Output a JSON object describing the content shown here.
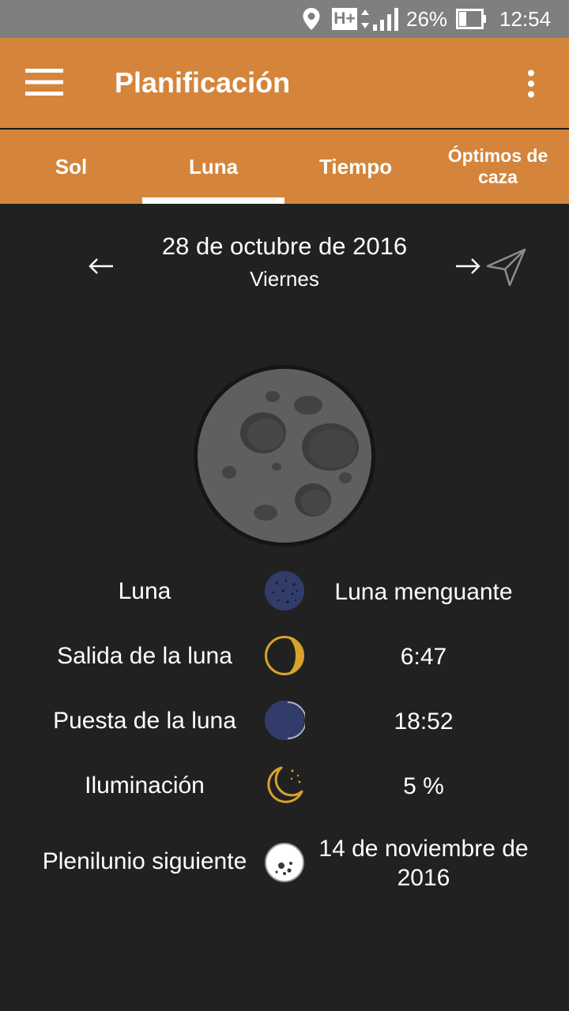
{
  "status_bar": {
    "network": "H+",
    "battery": "26%",
    "time": "12:54",
    "icons": [
      "location-icon",
      "network-icon",
      "signal-icon",
      "battery-icon"
    ]
  },
  "app_bar": {
    "title": "Planificación",
    "menu_icon": "hamburger-menu-icon",
    "overflow_icon": "more-vertical-icon"
  },
  "tabs": [
    {
      "label": "Sol",
      "selected": false
    },
    {
      "label": "Luna",
      "selected": true
    },
    {
      "label": "Tiempo",
      "selected": false
    },
    {
      "label": "Óptimos de caza",
      "selected": false
    }
  ],
  "date_nav": {
    "date": "28 de octubre de 2016",
    "weekday": "Viernes",
    "prev_icon": "arrow-left-icon",
    "next_icon": "arrow-right-icon",
    "location_icon": "navigation-icon"
  },
  "moon_info": {
    "rows": [
      {
        "label": "Luna",
        "icon": "moon-phase-icon",
        "value": "Luna menguante"
      },
      {
        "label": "Salida de la luna",
        "icon": "moonrise-icon",
        "value": "6:47"
      },
      {
        "label": "Puesta de la luna",
        "icon": "moonset-icon",
        "value": "18:52"
      },
      {
        "label": "Iluminación",
        "icon": "crescent-moon-icon",
        "value": "5 %"
      },
      {
        "label": "Plenilunio siguiente",
        "icon": "full-moon-icon",
        "value": "14 de noviembre de 2016"
      }
    ]
  },
  "colors": {
    "accent": "#d4853b",
    "background": "#212121",
    "status_bar": "#7f7f7f",
    "moon_gold": "#d9a22b",
    "moon_navy": "#323c6a"
  }
}
